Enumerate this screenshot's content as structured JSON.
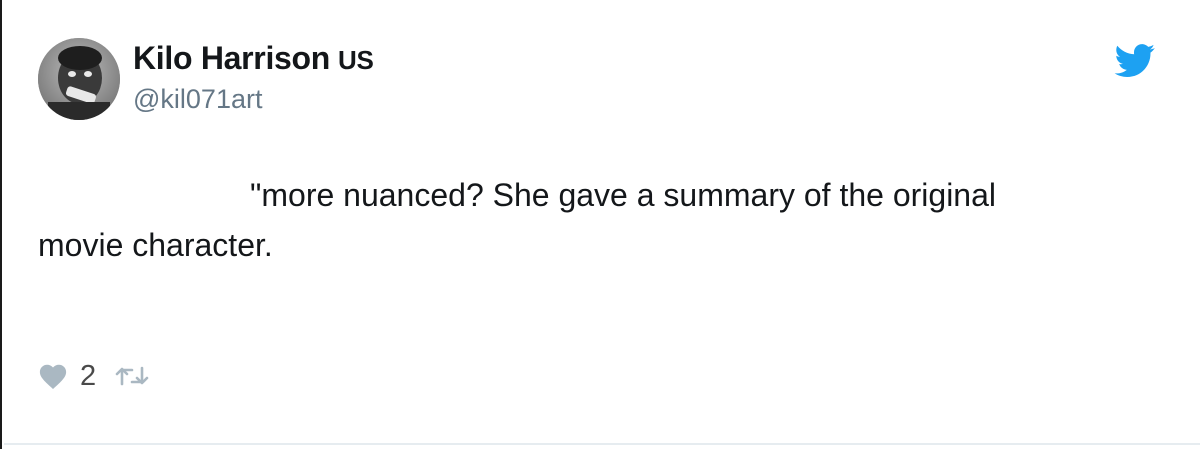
{
  "tweet": {
    "author": {
      "display_name": "Kilo Harrison",
      "country_badge": "US",
      "handle": "@kil071art"
    },
    "text_line1": "\"more nuanced? She gave a summary of the original",
    "text_line2": "movie character.",
    "actions": {
      "like_count": "2",
      "like_icon": "heart-icon",
      "retweet_icon": "retweet-icon"
    },
    "platform_icon": "twitter-bird-icon"
  },
  "colors": {
    "brand": "#1da1f2",
    "text": "#14171a",
    "muted": "#657786",
    "icon_gray": "#aab8c2"
  }
}
